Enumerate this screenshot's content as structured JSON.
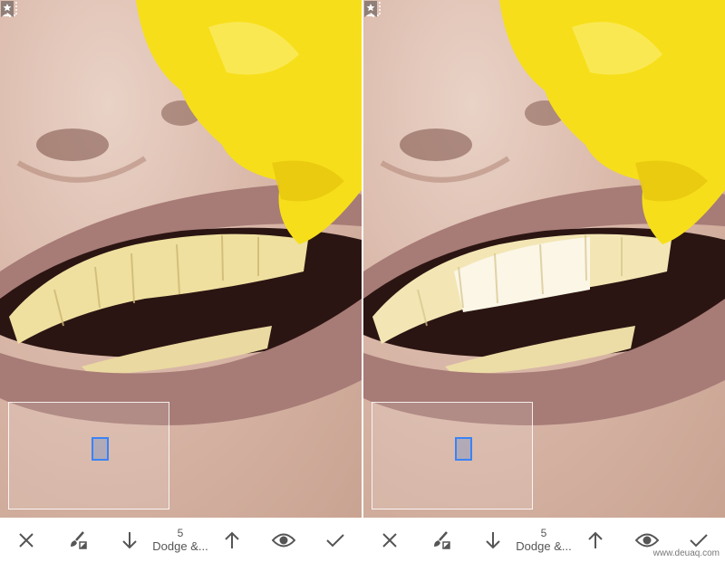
{
  "colors": {
    "accent": "#3b82f6",
    "icon": "#555555",
    "flower": "#f6df1a",
    "lip": "#a77b76"
  },
  "panes": [
    {
      "id": "before",
      "toolbar": {
        "value": "5",
        "label": "Dodge &..."
      }
    },
    {
      "id": "after",
      "toolbar": {
        "value": "5",
        "label": "Dodge &..."
      }
    }
  ],
  "icons": [
    "close-icon",
    "brush-icon",
    "arrow-down-icon",
    "arrow-up-icon",
    "eye-icon",
    "check-icon",
    "compare-icon",
    "bookmark-icon"
  ],
  "watermark": "www.deuaq.com"
}
